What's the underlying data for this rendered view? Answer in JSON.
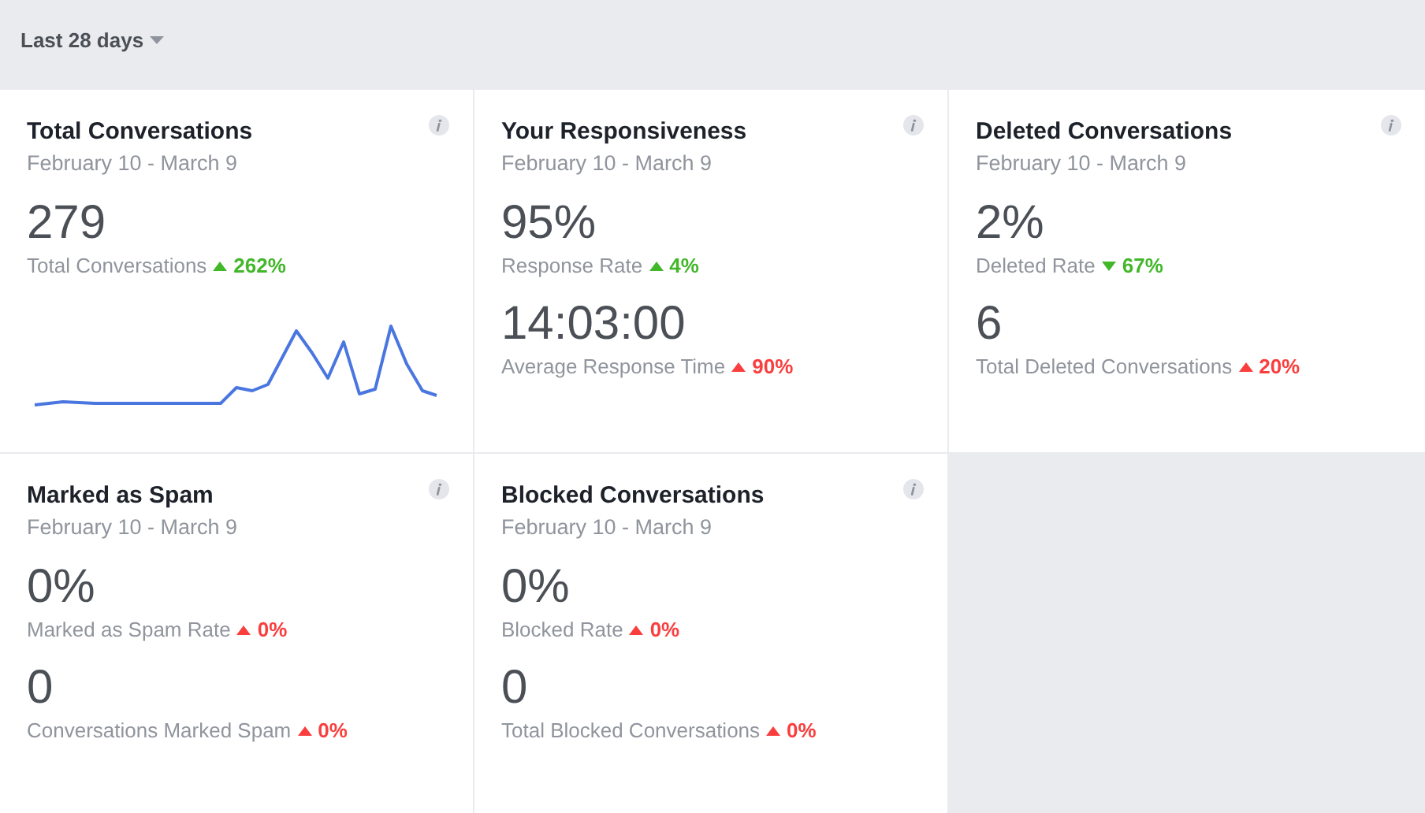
{
  "range_selector": {
    "label": "Last 28 days"
  },
  "cards": [
    {
      "title": "Total Conversations",
      "dates": "February 10 - March 9",
      "sparkline": true,
      "metrics": [
        {
          "value": "279",
          "label": "Total Conversations",
          "rising": true,
          "good": true,
          "change": "262%"
        }
      ]
    },
    {
      "title": "Your Responsiveness",
      "dates": "February 10 - March 9",
      "metrics": [
        {
          "value": "95%",
          "label": "Response Rate",
          "rising": true,
          "good": true,
          "change": "4%"
        },
        {
          "value": "14:03:00",
          "label": "Average Response Time",
          "rising": true,
          "good": false,
          "change": "90%"
        }
      ]
    },
    {
      "title": "Deleted Conversations",
      "dates": "February 10 - March 9",
      "metrics": [
        {
          "value": "2%",
          "label": "Deleted Rate",
          "rising": false,
          "good": true,
          "change": "67%"
        },
        {
          "value": "6",
          "label": "Total Deleted Conversations",
          "rising": true,
          "good": false,
          "change": "20%"
        }
      ]
    },
    {
      "title": "Marked as Spam",
      "dates": "February 10 - March 9",
      "metrics": [
        {
          "value": "0%",
          "label": "Marked as Spam Rate",
          "rising": true,
          "good": false,
          "change": "0%"
        },
        {
          "value": "0",
          "label": "Conversations Marked Spam",
          "rising": true,
          "good": false,
          "change": "0%"
        }
      ]
    },
    {
      "title": "Blocked Conversations",
      "dates": "February 10 - March 9",
      "metrics": [
        {
          "value": "0%",
          "label": "Blocked Rate",
          "rising": true,
          "good": false,
          "change": "0%"
        },
        {
          "value": "0",
          "label": "Total Blocked Conversations",
          "rising": true,
          "good": false,
          "change": "0%"
        }
      ]
    }
  ]
}
